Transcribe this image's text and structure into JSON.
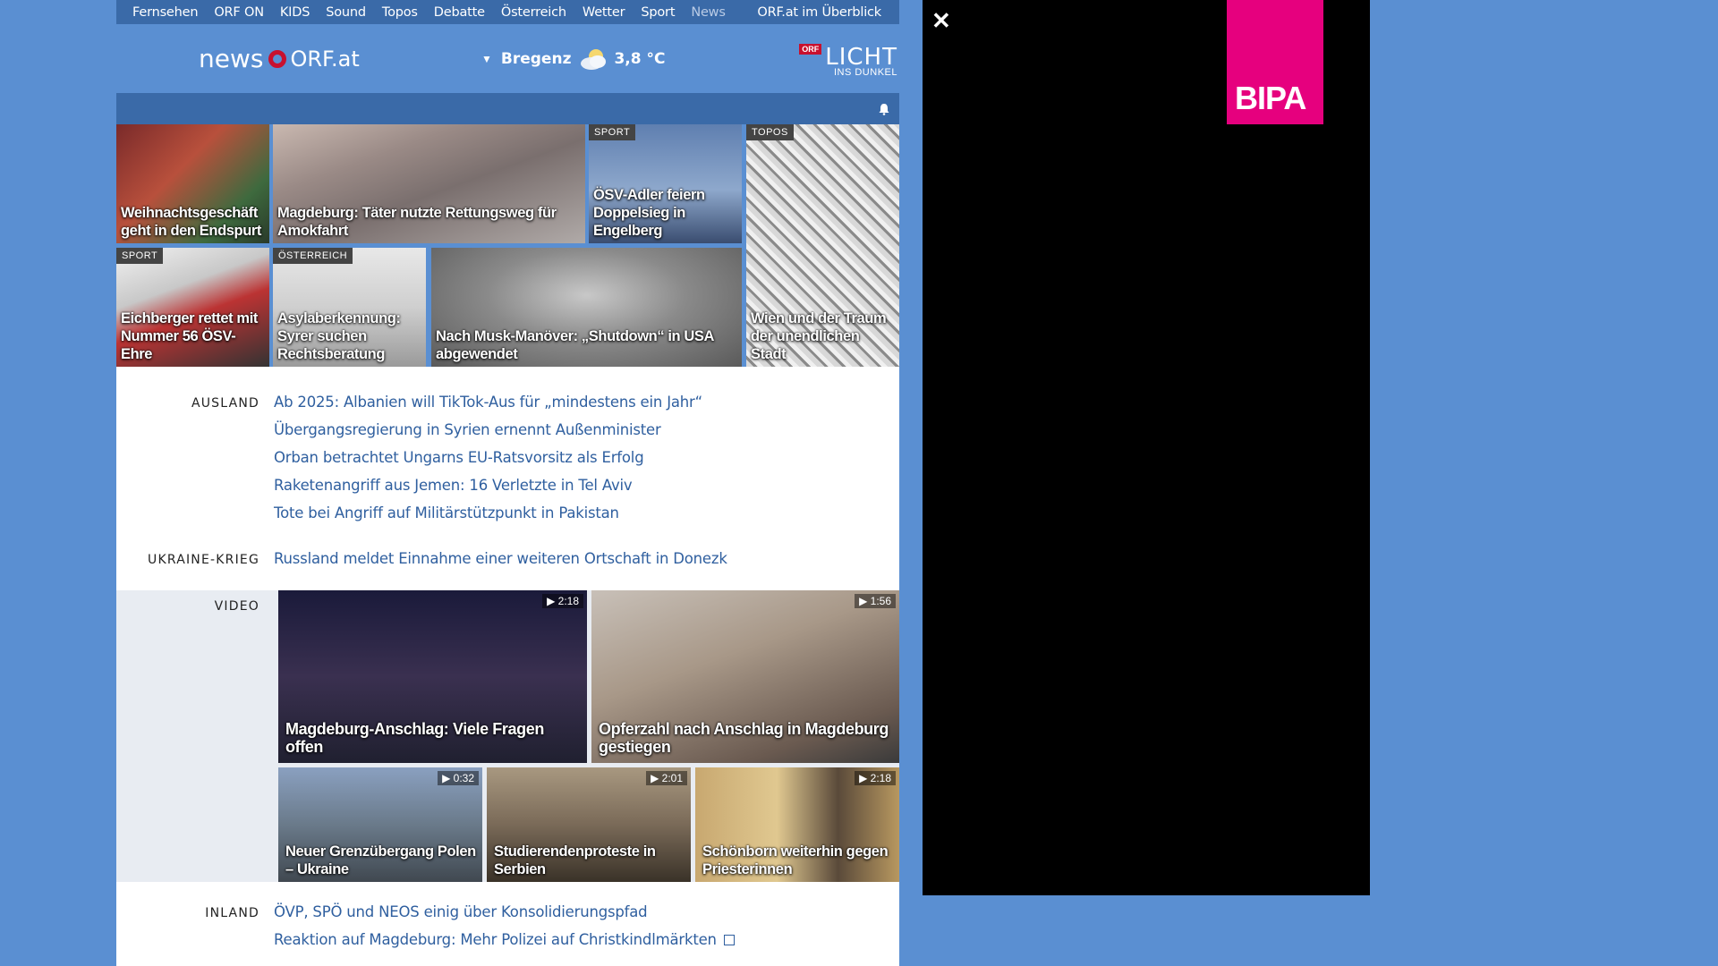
{
  "topnav": {
    "items": [
      "Fernsehen",
      "ORF ON",
      "KIDS",
      "Sound",
      "Topos",
      "Debatte",
      "Österreich",
      "Wetter",
      "Sport",
      "News"
    ],
    "overview": "ORF.at im Überblick"
  },
  "header": {
    "logo_news": "news",
    "logo_orf": "ORF.at",
    "weather_city": "Bregenz",
    "weather_temp": "3,8 °C",
    "campaign_badge": "ORF",
    "campaign_big": "LICHT",
    "campaign_small": "INS DUNKEL"
  },
  "tiles": [
    {
      "caption": "Weihnachtsgeschäft geht in den Endspurt",
      "badge": ""
    },
    {
      "caption": "Magdeburg: Täter nutzte Rettungsweg für Amokfahrt",
      "badge": ""
    },
    {
      "caption": "ÖSV-Adler feiern Doppelsieg in Engelberg",
      "badge": "SPORT"
    },
    {
      "caption": "Wien und der Traum der unendlichen Stadt",
      "badge": "TOPOS"
    },
    {
      "caption": "Eichberger rettet mit Nummer 56 ÖSV-Ehre",
      "badge": "SPORT"
    },
    {
      "caption": "Asylaberkennung: Syrer suchen Rechtsberatung",
      "badge": "ÖSTERREICH"
    },
    {
      "caption": "Nach Musk-Manöver: „Shutdown“ in USA abgewendet",
      "badge": ""
    }
  ],
  "sections": {
    "ausland": {
      "label": "AUSLAND",
      "links": [
        "Ab 2025: Albanien will TikTok-Aus für „mindestens ein Jahr“",
        "Übergangsregierung in Syrien ernennt Außenminister",
        "Orban betrachtet Ungarns EU-Ratsvorsitz als Erfolg",
        "Raketenangriff aus Jemen: 16 Verletzte in Tel Aviv",
        "Tote bei Angriff auf Militärstützpunkt in Pakistan"
      ]
    },
    "ukraine": {
      "label": "UKRAINE-KRIEG",
      "links": [
        "Russland meldet Einnahme einer weiteren Ortschaft in Donezk"
      ]
    },
    "video": {
      "label": "VIDEO",
      "items": [
        {
          "caption": "Magdeburg-Anschlag: Viele Fragen offen",
          "duration": "▶ 2:18"
        },
        {
          "caption": "Opferzahl nach Anschlag in Magdeburg gestiegen",
          "duration": "▶ 1:56"
        },
        {
          "caption": "Neuer Grenzübergang Polen – Ukraine",
          "duration": "▶ 0:32"
        },
        {
          "caption": "Studierendenproteste in Serbien",
          "duration": "▶ 2:01"
        },
        {
          "caption": "Schönborn weiterhin gegen Priesterinnen",
          "duration": "▶ 2:18"
        }
      ]
    },
    "inland": {
      "label": "INLAND",
      "links": [
        "ÖVP, SPÖ und NEOS einig über Konsolidierungspfad",
        "Reaktion auf Magdeburg: Mehr Polizei auf Christkindlmärkten"
      ]
    }
  },
  "ad": {
    "close": "✕",
    "brand": "BIPA"
  },
  "colors": {
    "background": "#5a8fd2",
    "nav": "#3a6aa8",
    "link": "#2f5f9f",
    "brand_red": "#c8102e",
    "bipa_pink": "#e6007e"
  }
}
